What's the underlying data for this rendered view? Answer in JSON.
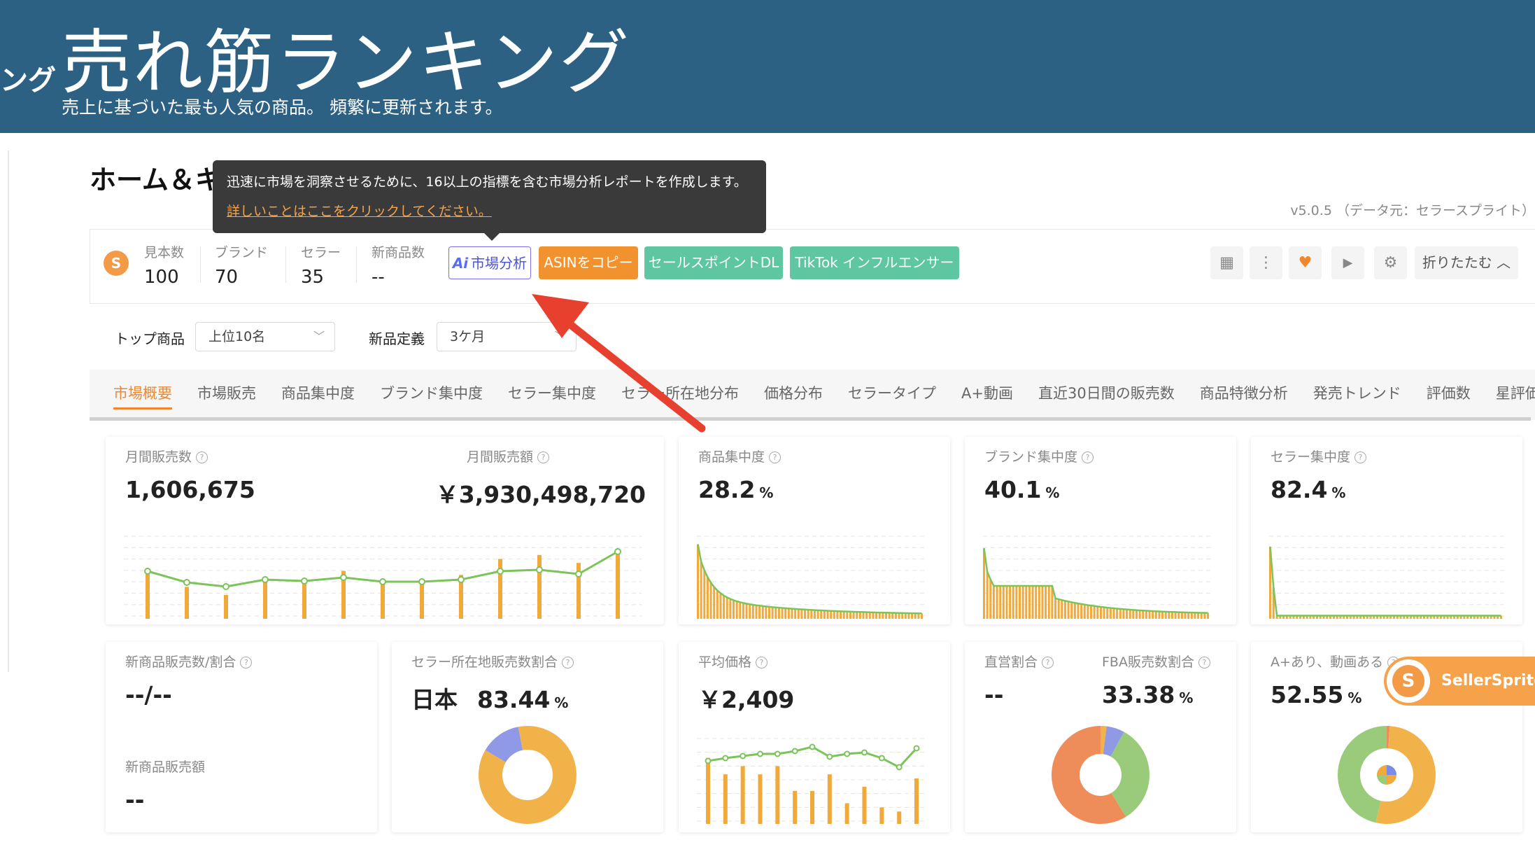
{
  "banner": {
    "edge_text": "ング",
    "title": "売れ筋ランキング",
    "subtitle": "売上に基づいた最も人気の商品。 頻繁に更新されます。"
  },
  "page": {
    "title": "ホーム＆キッチンの売れ筋ランキング",
    "version": "v5.0.5 （データ元：セラースプライト）"
  },
  "tooltip": {
    "text": "迅速に市場を洞察させるために、16以上の指標を含む市場分析レポートを作成します。",
    "link": "詳しいことはここをクリックしてください。"
  },
  "stats": {
    "logo": "S",
    "sample": {
      "label": "見本数",
      "value": "100"
    },
    "brand": {
      "label": "ブランド",
      "value": "70"
    },
    "seller": {
      "label": "セラー",
      "value": "35"
    },
    "newcount": {
      "label": "新商品数",
      "value": "--"
    }
  },
  "buttons": {
    "ai_icon": "Ai",
    "ai_label": "市場分析",
    "asin": "ASINをコピー",
    "sale": "セールスポイントDL",
    "tiktok": "TikTok インフルエンサー",
    "fold": "折りたたむ ︿"
  },
  "icons": {
    "grid": "▦",
    "more": "⋮",
    "heart": "♥",
    "video": "▶",
    "settings": "⚙"
  },
  "filters": {
    "top_label": "トップ商品",
    "top_value": "上位10名",
    "new_label": "新品定義",
    "new_value": "3ケ月",
    "chevron": "﹀"
  },
  "tabs": [
    "市場概要",
    "市場販売",
    "商品集中度",
    "ブランド集中度",
    "セラー集中度",
    "セラー所在地分布",
    "価格分布",
    "セラータイプ",
    "A+動画",
    "直近30日間の販売数",
    "商品特徴分析",
    "発売トレンド",
    "評価数",
    "星評価"
  ],
  "cards": {
    "monthly": {
      "sales_label": "月間販売数",
      "sales_value": "1,606,675",
      "revenue_label": "月間販売額",
      "revenue_value": "￥3,930,498,720"
    },
    "product_conc": {
      "label": "商品集中度",
      "value": "28.2",
      "unit": "%"
    },
    "brand_conc": {
      "label": "ブランド集中度",
      "value": "40.1",
      "unit": "%"
    },
    "seller_conc": {
      "label": "セラー集中度",
      "value": "82.4",
      "unit": "%"
    },
    "new_product": {
      "label": "新商品販売数/割合",
      "value": "--/--",
      "label2": "新商品販売額",
      "value2": "--"
    },
    "seller_location": {
      "label": "セラー所在地販売数割合",
      "country": "日本",
      "value": "83.44",
      "unit": "%"
    },
    "avg_price": {
      "label": "平均価格",
      "value": "￥2,409"
    },
    "direct": {
      "label": "直営割合",
      "value": "--",
      "fba_label": "FBA販売数割合",
      "fba_value": "33.38",
      "unit": "%"
    },
    "aplus": {
      "label": "A+あり、動画ある",
      "value": "52.55",
      "unit": "%"
    }
  },
  "qm": "?",
  "badge": {
    "logo": "S",
    "text": "SellerSprite"
  },
  "colors": {
    "banner": "#2d6184",
    "orange": "#f2922f",
    "teal": "#5ec6a0",
    "line_green": "#7cc35a",
    "bar_orange": "#f2a93b"
  }
}
